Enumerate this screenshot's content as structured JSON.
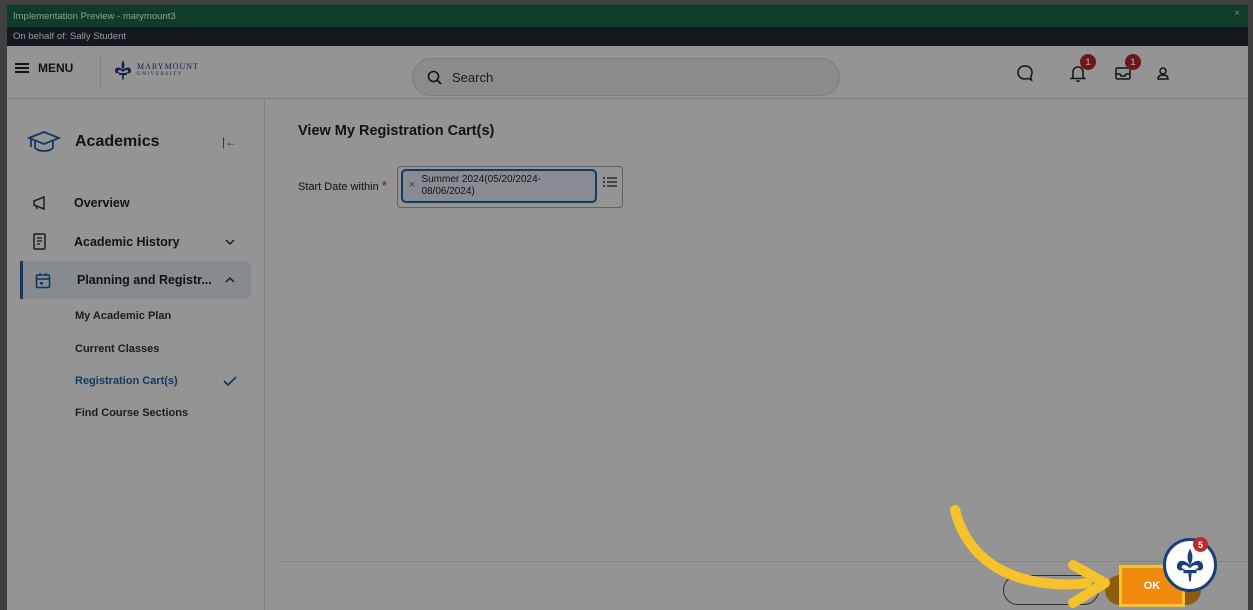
{
  "banner": {
    "title": "Implementation Preview - marymount3",
    "close": "×"
  },
  "behalf": {
    "text": "On behalf of: Sally Student"
  },
  "header": {
    "menu_label": "MENU",
    "logo_top": "MARYMOUNT",
    "logo_bottom": "UNIVERSITY",
    "search_placeholder": "Search",
    "notifications_count": "1",
    "inbox_count": "1"
  },
  "sidebar": {
    "title": "Academics",
    "items": [
      {
        "label": "Overview"
      },
      {
        "label": "Academic History"
      },
      {
        "label": "Planning and Registr..."
      }
    ],
    "sub_items": [
      {
        "label": "My Academic Plan"
      },
      {
        "label": "Current Classes"
      },
      {
        "label": "Registration Cart(s)"
      },
      {
        "label": "Find Course Sections"
      }
    ]
  },
  "main": {
    "title": "View My Registration Cart(s)",
    "field_label": "Start Date within",
    "required_mark": "*",
    "selected_line1": "Summer 2024(05/20/2024-",
    "selected_line2": "08/06/2024)",
    "remove": "×",
    "ok_label": "OK"
  },
  "helper": {
    "badge": "5"
  },
  "colors": {
    "accent": "#1f62a9",
    "ok": "#f0a117",
    "highlight": "#f6c22b",
    "badge": "#c0272d",
    "banner": "#1d6a45"
  }
}
